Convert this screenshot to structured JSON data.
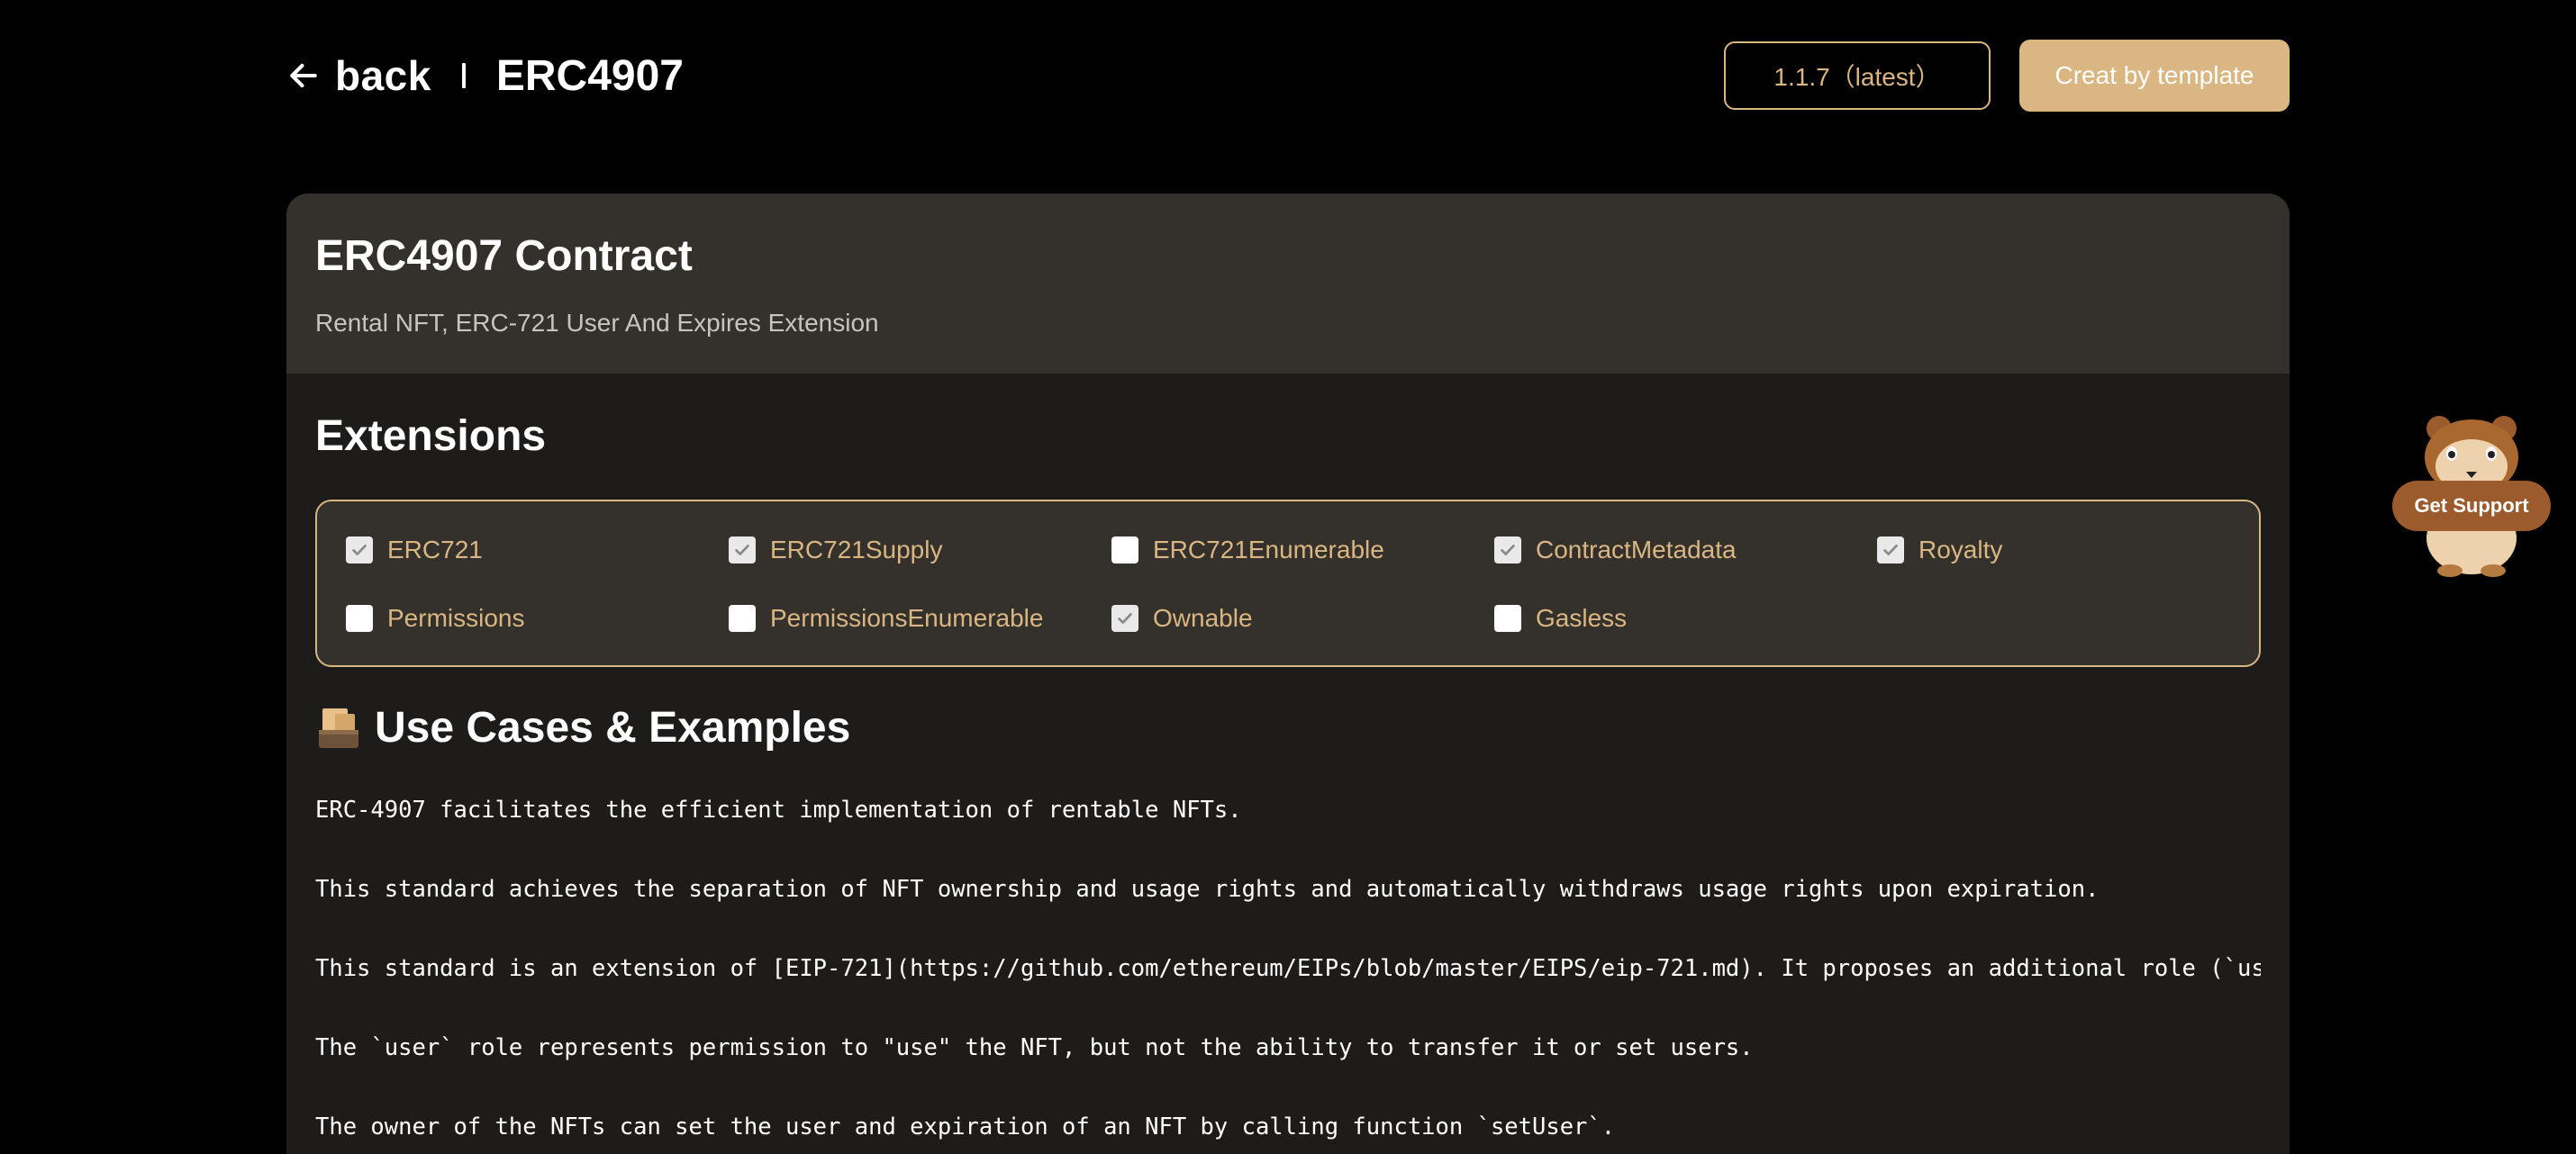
{
  "header": {
    "back_label": "back",
    "title": "ERC4907",
    "version_label": "1.1.7（latest）",
    "create_label": "Creat by template"
  },
  "card": {
    "title": "ERC4907 Contract",
    "subtitle": "Rental NFT, ERC-721 User And Expires Extension"
  },
  "extensions": {
    "heading": "Extensions",
    "items": [
      {
        "label": "ERC721",
        "checked": true
      },
      {
        "label": "ERC721Supply",
        "checked": true
      },
      {
        "label": "ERC721Enumerable",
        "checked": false
      },
      {
        "label": "ContractMetadata",
        "checked": true
      },
      {
        "label": "Royalty",
        "checked": true
      },
      {
        "label": "Permissions",
        "checked": false
      },
      {
        "label": "PermissionsEnumerable",
        "checked": false
      },
      {
        "label": "Ownable",
        "checked": true
      },
      {
        "label": "Gasless",
        "checked": false
      }
    ]
  },
  "use_cases": {
    "heading": "Use Cases & Examples",
    "icon": "box-icon",
    "lines": [
      "ERC-4907 facilitates the efficient implementation of rentable NFTs.",
      "This standard achieves the separation of NFT ownership and usage rights and automatically withdraws usage rights upon expiration.",
      "This standard is an extension of [EIP-721](https://github.com/ethereum/EIPs/blob/master/EIPS/eip-721.md). It proposes an additional role (`us",
      "The `user` role represents permission to \"use\" the NFT, but not the ability to transfer it or set users.",
      "The owner of the NFTs can set the user and expiration of an NFT by calling function `setUser`."
    ]
  },
  "support": {
    "label": "Get Support",
    "icon": "hamster-mascot-icon"
  },
  "colors": {
    "accent": "#dab682",
    "background": "#000000",
    "card_header": "#34302c",
    "card_body": "#1e1c1b",
    "support_badge": "#9b5b2c"
  }
}
